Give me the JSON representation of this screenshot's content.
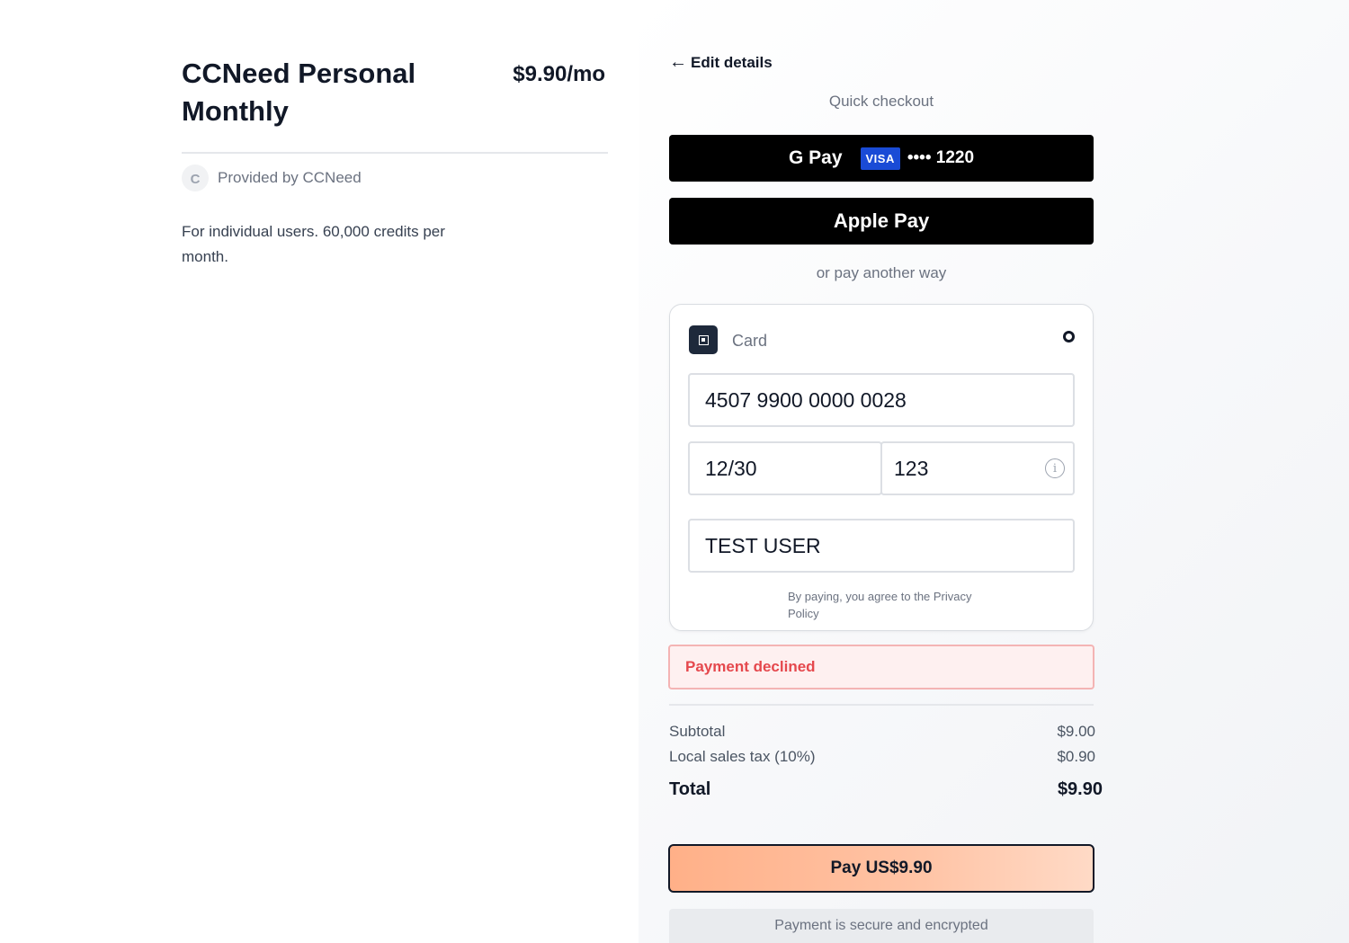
{
  "product": {
    "title": "CCNeed Personal Monthly",
    "price": "$9.90/mo",
    "provider_initial": "C",
    "provider_text": "Provided by CCNeed",
    "description": "For individual users. 60,000 credits per month."
  },
  "checkout": {
    "edit_arrow": "←",
    "edit_label": "Edit details",
    "quick_checkout": "Quick checkout",
    "gpay_label": "G Pay",
    "gpay_card_brand": "VISA",
    "gpay_card_last4": "•••• 1220",
    "applepay_label": "Apple Pay",
    "or_pay": "or pay another way"
  },
  "card_form": {
    "method_label": "Card",
    "card_number": "4507 9900 0000 0028",
    "expiry": "12/30",
    "cvc": "123",
    "cvc_info_glyph": "i",
    "name": "TEST USER",
    "privacy_text": "By paying, you agree to the Privacy Policy"
  },
  "error": {
    "message": "Payment declined"
  },
  "summary": {
    "subtotal_label": "Subtotal",
    "subtotal_value": "$9.00",
    "tax_label": "Local sales tax (10%)",
    "tax_value": "$0.90",
    "total_label": "Total",
    "total_value": "$9.90"
  },
  "pay_button": "Pay US$9.90",
  "secure_note": "Payment is secure and encrypted",
  "colors": {
    "wallet_button": "#000000",
    "visa_badge": "#1a4bd6",
    "error_text": "#e5484d",
    "error_bg": "#fef0f0",
    "pay_gradient_start": "#ffb088",
    "pay_gradient_end": "#ffdac6"
  }
}
